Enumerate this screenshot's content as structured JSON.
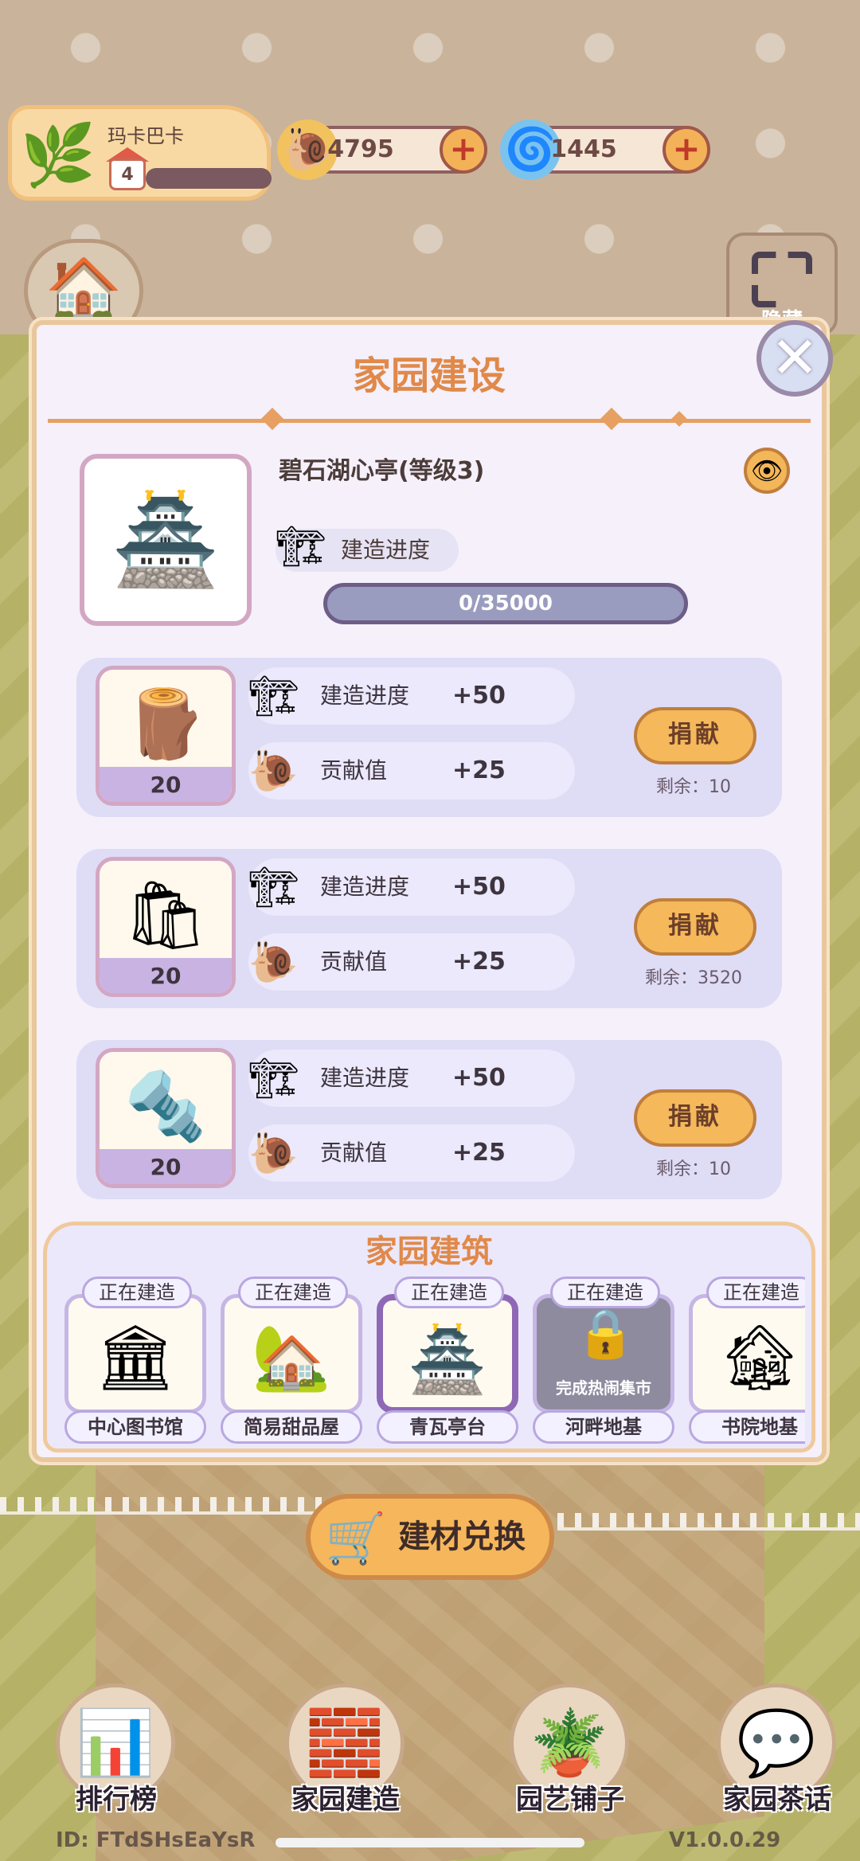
{
  "hud": {
    "player_name": "玛卡巴卡",
    "level": "4",
    "snail_coins": "4795",
    "gems": "1445",
    "hide_label": "隐藏"
  },
  "panel": {
    "title": "家园建设",
    "building_name": "碧石湖心亭(等级3)",
    "progress_label": "建造进度",
    "progress_text": "0/35000",
    "progress_fraction": 0.0
  },
  "donations": [
    {
      "material_icon": "wood-logs",
      "quantity": "20",
      "progress_label": "建造进度",
      "progress_value": "+50",
      "contrib_label": "贡献值",
      "contrib_value": "+25",
      "button": "捐献",
      "remaining": "剩余：10"
    },
    {
      "material_icon": "cement-bags",
      "quantity": "20",
      "progress_label": "建造进度",
      "progress_value": "+50",
      "contrib_label": "贡献值",
      "contrib_value": "+25",
      "button": "捐献",
      "remaining": "剩余：3520"
    },
    {
      "material_icon": "steel-beams",
      "quantity": "20",
      "progress_label": "建造进度",
      "progress_value": "+50",
      "contrib_label": "贡献值",
      "contrib_value": "+25",
      "button": "捐献",
      "remaining": "剩余：10"
    }
  ],
  "strip": {
    "title": "家园建筑",
    "buildings": [
      {
        "tag": "正在建造",
        "name": "中心图书馆"
      },
      {
        "tag": "正在建造",
        "name": "简易甜品屋"
      },
      {
        "tag": "正在建造",
        "name": "青瓦亭台"
      },
      {
        "tag": "正在建造",
        "name": "河畔地基",
        "lock_note": "完成热闹集市"
      },
      {
        "tag": "正在建造",
        "name": "书院地基"
      }
    ]
  },
  "exchange_button": "建材兑换",
  "nav": [
    {
      "label": "排行榜",
      "icon": "ranking-icon"
    },
    {
      "label": "家园建造",
      "icon": "bricks-icon"
    },
    {
      "label": "园艺铺子",
      "icon": "plant-pot-icon"
    },
    {
      "label": "家园茶话",
      "icon": "chat-icon"
    }
  ],
  "footer": {
    "id_text": "ID: FTdSHsEaYsR",
    "version_text": "V1.0.0.29"
  },
  "colors": {
    "title_orange": "#e0894a",
    "button_orange": "#f5b85a",
    "panel_bg": "#f5f0fa",
    "card_lavender": "#dfdcf6"
  }
}
